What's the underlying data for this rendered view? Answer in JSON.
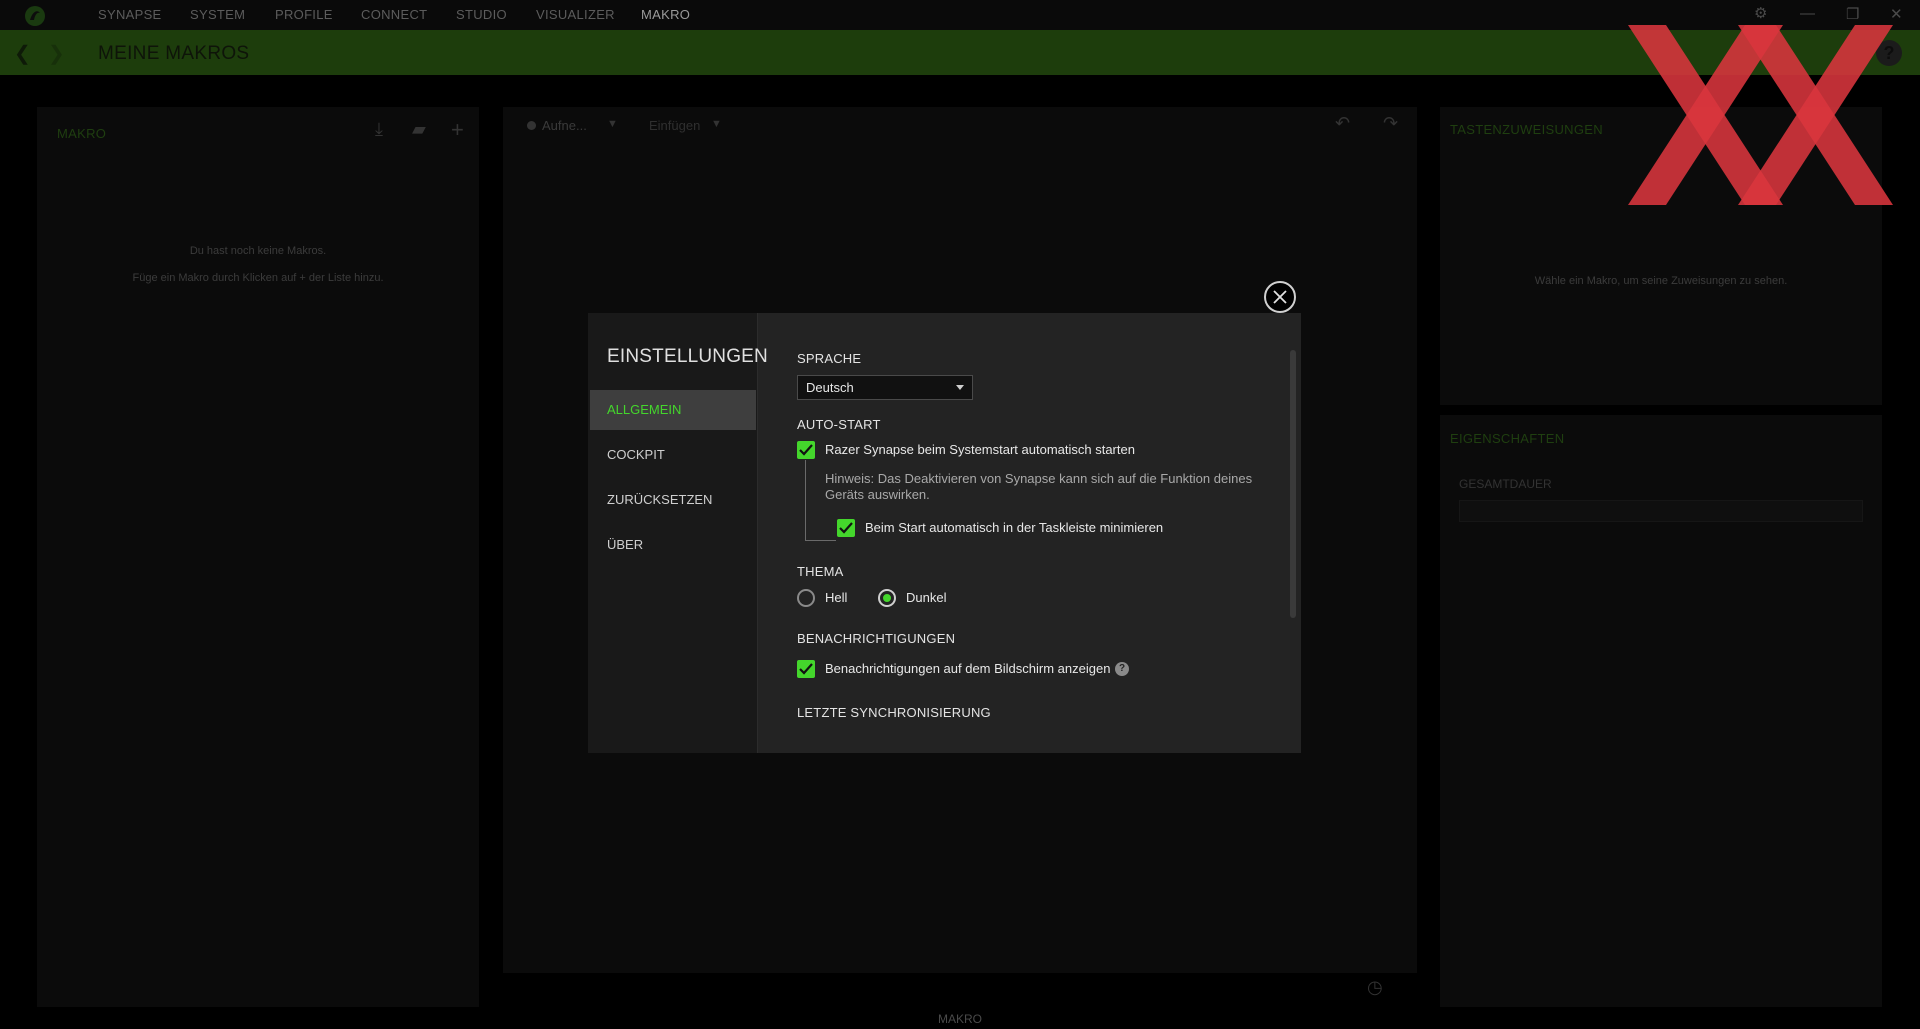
{
  "nav": {
    "items": [
      "SYNAPSE",
      "SYSTEM",
      "PROFILE",
      "CONNECT",
      "STUDIO",
      "VISUALIZER",
      "MAKRO"
    ],
    "active": "MAKRO"
  },
  "header": {
    "title": "MEINE MAKROS"
  },
  "left_panel": {
    "title": "MAKRO",
    "empty_line1": "Du hast noch keine Makros.",
    "empty_line2": "Füge ein Makro durch Klicken auf + der Liste hinzu."
  },
  "mid_panel": {
    "record_label": "Aufne...",
    "insert_label": "Einfügen",
    "footer": "MAKRO"
  },
  "right_panel": {
    "assign_title": "TASTENZUWEISUNGEN",
    "assign_empty": "Wähle ein Makro, um seine Zuweisungen zu sehen.",
    "props_title": "EIGENSCHAFTEN",
    "duration_label": "GESAMTDAUER"
  },
  "settings": {
    "title": "EINSTELLUNGEN",
    "nav": [
      "ALLGEMEIN",
      "COCKPIT",
      "ZURÜCKSETZEN",
      "ÜBER"
    ],
    "active_nav": "ALLGEMEIN",
    "language": {
      "label": "SPRACHE",
      "value": "Deutsch"
    },
    "autostart": {
      "label": "AUTO-START",
      "start_option": "Razer Synapse beim Systemstart automatisch starten",
      "start_checked": true,
      "hint_line1": "Hinweis: Das Deaktivieren von Synapse kann sich auf die Funktion deines",
      "hint_line2": "Geräts auswirken.",
      "minimize_option": "Beim Start automatisch in der Taskleiste minimieren",
      "minimize_checked": true
    },
    "theme": {
      "label": "THEMA",
      "options": [
        "Hell",
        "Dunkel"
      ],
      "selected": "Dunkel"
    },
    "notifications": {
      "label": "BENACHRICHTIGUNGEN",
      "option": "Benachrichtigungen auf dem Bildschirm anzeigen",
      "checked": true
    },
    "sync": {
      "label": "LETZTE SYNCHRONISIERUNG"
    }
  },
  "colors": {
    "accent": "#44d62c",
    "header_bg": "#1d3d0c",
    "modal_bg": "#232323",
    "watermark": "#d9363e"
  },
  "icons": [
    "razer-logo-icon",
    "gear-icon",
    "minimize-icon",
    "maximize-icon",
    "close-icon",
    "back-arrow-icon",
    "forward-arrow-icon",
    "help-icon",
    "import-icon",
    "folder-icon",
    "plus-icon",
    "record-dot-icon",
    "chevron-down-icon",
    "undo-icon",
    "redo-icon",
    "clock-icon",
    "checkmark-icon",
    "question-icon"
  ]
}
